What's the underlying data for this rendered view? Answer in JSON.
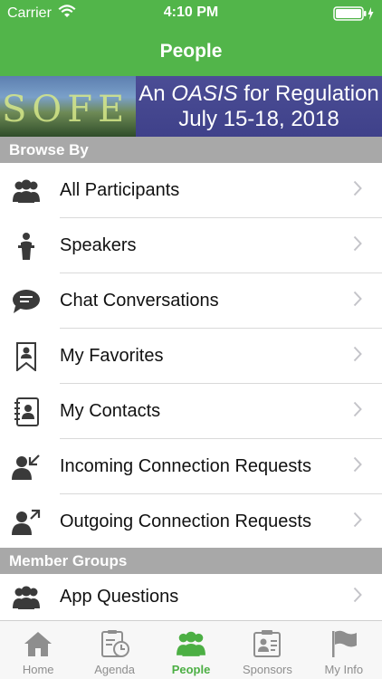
{
  "status_bar": {
    "carrier": "Carrier",
    "time": "4:10 PM"
  },
  "nav": {
    "title": "People"
  },
  "banner": {
    "logo_text": "SOFE",
    "line1_prefix": "An ",
    "line1_oasis": "OASIS",
    "line1_suffix": " for Regulation",
    "line2": "July 15-18, 2018"
  },
  "sections": {
    "browse_by": "Browse By",
    "member_groups": "Member Groups"
  },
  "browse_items": [
    {
      "label": "All Participants",
      "icon": "group-icon"
    },
    {
      "label": "Speakers",
      "icon": "speaker-icon"
    },
    {
      "label": "Chat Conversations",
      "icon": "chat-bubble-icon"
    },
    {
      "label": "My Favorites",
      "icon": "bookmark-person-icon"
    },
    {
      "label": "My Contacts",
      "icon": "contacts-book-icon"
    },
    {
      "label": "Incoming Connection Requests",
      "icon": "person-incoming-icon"
    },
    {
      "label": "Outgoing Connection Requests",
      "icon": "person-outgoing-icon"
    }
  ],
  "member_group_items": [
    {
      "label": "App Questions",
      "icon": "group-icon"
    }
  ],
  "tabs": [
    {
      "label": "Home",
      "icon": "home-icon",
      "active": false
    },
    {
      "label": "Agenda",
      "icon": "agenda-icon",
      "active": false
    },
    {
      "label": "People",
      "icon": "people-icon",
      "active": true
    },
    {
      "label": "Sponsors",
      "icon": "sponsors-icon",
      "active": false
    },
    {
      "label": "My Info",
      "icon": "flag-icon",
      "active": false
    }
  ],
  "colors": {
    "brand_green": "#52b54a",
    "section_gray": "#a8a8a8",
    "banner_purple": "#4b4d95",
    "tab_active": "#4caf44",
    "tab_inactive": "#8e8e8e"
  }
}
